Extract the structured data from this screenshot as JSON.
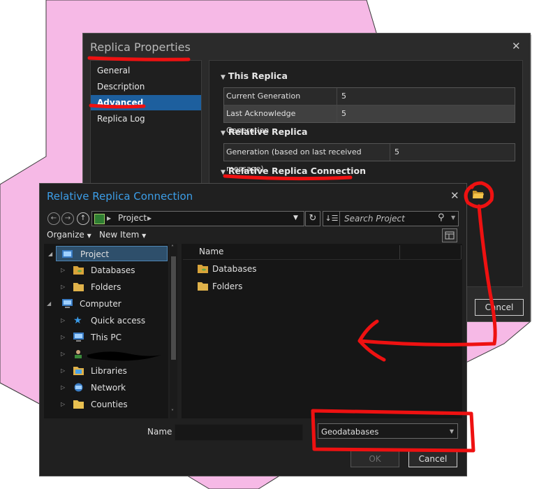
{
  "colors": {
    "accent": "#1d5f9e",
    "title_blue": "#3c9ee8",
    "annotation": "#ee1111",
    "map_pink": "#f6b9e6"
  },
  "replica_properties": {
    "title": "Replica Properties",
    "nav": [
      "General",
      "Description",
      "Advanced",
      "Replica Log"
    ],
    "selected_nav": "Advanced",
    "sections": {
      "this_replica": "This Replica",
      "relative_replica": "Relative Replica",
      "relative_replica_connection": "Relative Replica Connection"
    },
    "this_replica_rows": [
      {
        "key": "Current Generation",
        "value": "5"
      },
      {
        "key": "Last Acknowledge Generation",
        "value": "5"
      }
    ],
    "relative_replica_rows": [
      {
        "key": "Generation (based on last received message)",
        "value": "5"
      }
    ],
    "cancel_label": "Cancel",
    "browse_icon": "open-folder-icon"
  },
  "connection_dialog": {
    "title": "Relative Replica Connection",
    "address_path": "Project",
    "search_placeholder": "Search Project",
    "organize_label": "Organize",
    "new_item_label": "New Item",
    "tree": [
      {
        "label": "Project",
        "icon": "project-icon",
        "selected": true
      },
      {
        "label": "Databases",
        "icon": "database-folder-icon"
      },
      {
        "label": "Folders",
        "icon": "folder-icon"
      },
      {
        "label": "Computer",
        "icon": "computer-icon"
      },
      {
        "label": "Quick access",
        "icon": "star-icon"
      },
      {
        "label": "This PC",
        "icon": "pc-icon"
      },
      {
        "label": "",
        "icon": "user-icon"
      },
      {
        "label": "Libraries",
        "icon": "libraries-icon"
      },
      {
        "label": "Network",
        "icon": "network-icon"
      },
      {
        "label": "Counties",
        "icon": "folder-icon"
      }
    ],
    "column_header": "Name",
    "items": [
      {
        "label": "Databases",
        "icon": "database-folder-icon"
      },
      {
        "label": "Folders",
        "icon": "folder-icon"
      }
    ],
    "name_label": "Name",
    "name_value": "",
    "file_type": "Geodatabases",
    "ok_label": "OK",
    "cancel_label": "Cancel"
  }
}
